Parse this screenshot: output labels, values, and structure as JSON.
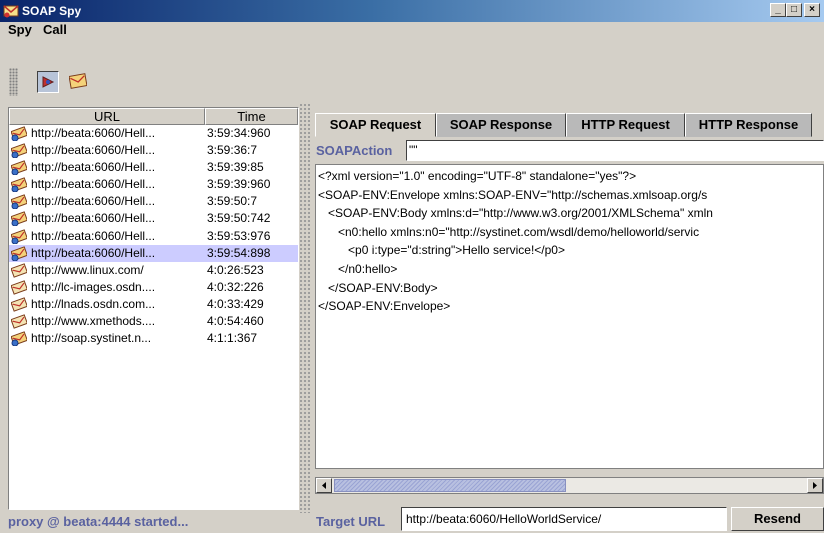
{
  "window": {
    "title": "SOAP Spy",
    "min": "_",
    "max": "□",
    "close": "×"
  },
  "menu": [
    "Spy",
    "Call"
  ],
  "toolbar": {
    "buttons": [
      "record-icon",
      "envelope-icon"
    ]
  },
  "table": {
    "columns": [
      "URL",
      "Time"
    ],
    "rows": [
      {
        "url": "http://beata:6060/Hell...",
        "time": "3:59:34:960",
        "icon": "soap-icon"
      },
      {
        "url": "http://beata:6060/Hell...",
        "time": "3:59:36:7",
        "icon": "soap-icon"
      },
      {
        "url": "http://beata:6060/Hell...",
        "time": "3:59:39:85",
        "icon": "soap-icon"
      },
      {
        "url": "http://beata:6060/Hell...",
        "time": "3:59:39:960",
        "icon": "soap-icon"
      },
      {
        "url": "http://beata:6060/Hell...",
        "time": "3:59:50:7",
        "icon": "soap-icon"
      },
      {
        "url": "http://beata:6060/Hell...",
        "time": "3:59:50:742",
        "icon": "soap-icon"
      },
      {
        "url": "http://beata:6060/Hell...",
        "time": "3:59:53:976",
        "icon": "soap-icon"
      },
      {
        "url": "http://beata:6060/Hell...",
        "time": "3:59:54:898",
        "icon": "soap-icon",
        "selected": true
      },
      {
        "url": "http://www.linux.com/",
        "time": "4:0:26:523",
        "icon": "http-icon"
      },
      {
        "url": "http://lc-images.osdn....",
        "time": "4:0:32:226",
        "icon": "http-icon"
      },
      {
        "url": "http://lnads.osdn.com...",
        "time": "4:0:33:429",
        "icon": "http-icon"
      },
      {
        "url": "http://www.xmethods....",
        "time": "4:0:54:460",
        "icon": "http-icon"
      },
      {
        "url": "http://soap.systinet.n...",
        "time": "4:1:1:367",
        "icon": "soap-icon"
      }
    ]
  },
  "tabs": [
    "SOAP Request",
    "SOAP Response",
    "HTTP Request",
    "HTTP Response"
  ],
  "soapaction": {
    "label": "SOAPAction",
    "value": "\"\""
  },
  "xml_lines": [
    "<?xml version=\"1.0\" encoding=\"UTF-8\" standalone=\"yes\"?>",
    "<SOAP-ENV:Envelope xmlns:SOAP-ENV=\"http://schemas.xmlsoap.org/s",
    "   <SOAP-ENV:Body xmlns:d=\"http://www.w3.org/2001/XMLSchema\" xmln",
    "      <n0:hello xmlns:n0=\"http://systinet.com/wsdl/demo/helloworld/servic",
    "         <p0 i:type=\"d:string\">Hello service!</p0>",
    "      </n0:hello>",
    "   </SOAP-ENV:Body>",
    "</SOAP-ENV:Envelope>"
  ],
  "target": {
    "label": "Target URL",
    "value": "http://beata:6060/HelloWorldService/"
  },
  "resend_label": "Resend",
  "status": "proxy @ beata:4444 started...",
  "colors": {
    "selection": "#ccccff",
    "label": "#5a62a0",
    "title_gradient_start": "#0a246a"
  }
}
